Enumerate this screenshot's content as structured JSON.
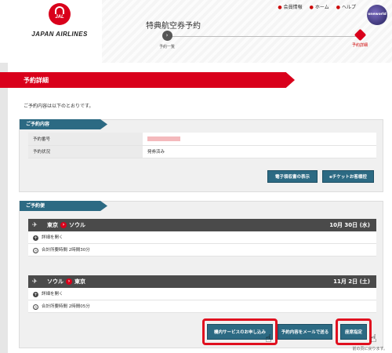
{
  "header": {
    "brand": "JAPAN AIRLINES",
    "logo_mark": "JAL",
    "title": "特典航空券予約",
    "util_links": [
      {
        "icon": "person-icon",
        "label": "会員情報"
      },
      {
        "icon": "home-icon",
        "label": "ホーム"
      },
      {
        "icon": "help-icon",
        "label": "ヘルプ"
      }
    ],
    "alliance_logo": "oneworld",
    "steps": [
      {
        "label": "予約一覧",
        "icon": "arrow-right-icon"
      },
      {
        "label": "予約詳細",
        "icon": "pin-icon"
      }
    ]
  },
  "main": {
    "banner_title": "予約詳細",
    "intro": "ご予約内容は以下のとおりです。",
    "reservation": {
      "tab_label": "ご予約内容",
      "rows": [
        {
          "key": "予約番号",
          "value": ""
        },
        {
          "key": "予約状況",
          "value": "発券済み"
        }
      ],
      "buttons": [
        "電子領収書の表示",
        "eチケットお客様控"
      ]
    },
    "flights": {
      "tab_label": "ご予約便",
      "items": [
        {
          "from": "東京",
          "to": "ソウル",
          "date": "10月 30日 (水)",
          "expand_label": "詳細を開く",
          "duration": "合計所要時間 2時間30分"
        },
        {
          "from": "ソウル",
          "to": "東京",
          "date": "11月 2日 (土)",
          "expand_label": "詳細を開く",
          "duration": "合計所要時間 2時間05分"
        }
      ]
    },
    "actions": [
      "機内サービスのお申し込み",
      "予約内容をメールで送る",
      "座席指定"
    ],
    "footnote": "前の頁に戻ります。"
  },
  "colors": {
    "brand_red": "#d9001b",
    "tab_blue": "#2c6a83",
    "flight_header": "#4a4a4a"
  }
}
